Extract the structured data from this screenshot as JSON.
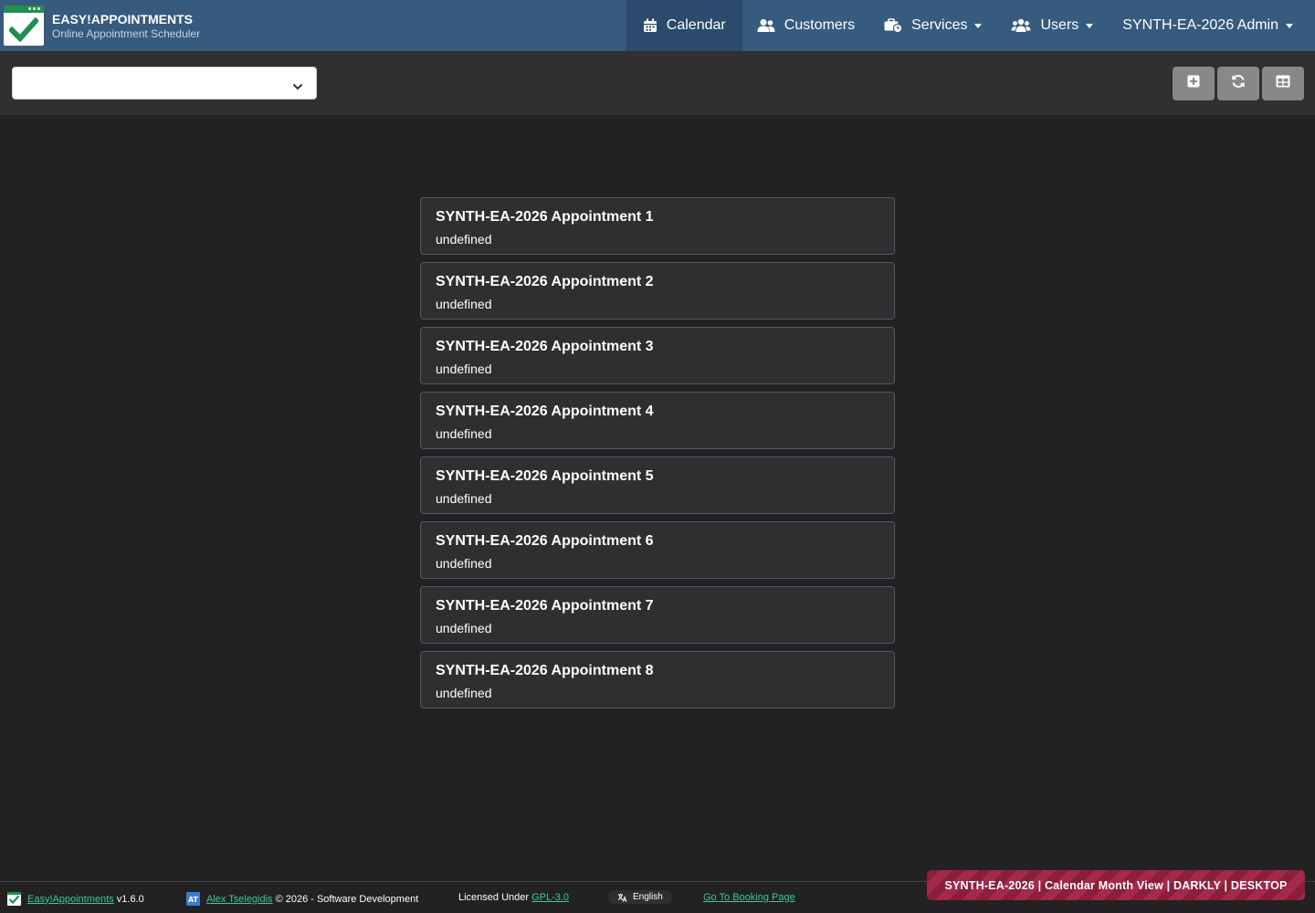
{
  "header": {
    "brand_title": "EASY!APPOINTMENTS",
    "brand_subtitle": "Online Appointment Scheduler",
    "nav": {
      "calendar": "Calendar",
      "customers": "Customers",
      "services": "Services",
      "users": "Users",
      "admin": "SYNTH-EA-2026 Admin"
    }
  },
  "toolbar": {
    "select_value": ""
  },
  "appointments": [
    {
      "title": "SYNTH-EA-2026 Appointment 1",
      "subtitle": "undefined"
    },
    {
      "title": "SYNTH-EA-2026 Appointment 2",
      "subtitle": "undefined"
    },
    {
      "title": "SYNTH-EA-2026 Appointment 3",
      "subtitle": "undefined"
    },
    {
      "title": "SYNTH-EA-2026 Appointment 4",
      "subtitle": "undefined"
    },
    {
      "title": "SYNTH-EA-2026 Appointment 5",
      "subtitle": "undefined"
    },
    {
      "title": "SYNTH-EA-2026 Appointment 6",
      "subtitle": "undefined"
    },
    {
      "title": "SYNTH-EA-2026 Appointment 7",
      "subtitle": "undefined"
    },
    {
      "title": "SYNTH-EA-2026 Appointment 8",
      "subtitle": "undefined"
    }
  ],
  "footer": {
    "app_link": "Easy!Appointments",
    "version": "v1.6.0",
    "author_link": "Alex Tselegidis",
    "copyright": "© 2026 - Software Development",
    "license_prefix": "Licensed Under",
    "license_link": "GPL-3.0",
    "language": "English",
    "booking_link": "Go To Booking Page"
  },
  "banner": "SYNTH-EA-2026 | Calendar Month View | DARKLY | DESKTOP",
  "colors": {
    "header": "#375a7f",
    "background": "#222222",
    "toolbar": "#303030",
    "link": "#3ec6a0",
    "brand_green": "#1f8f4e"
  }
}
